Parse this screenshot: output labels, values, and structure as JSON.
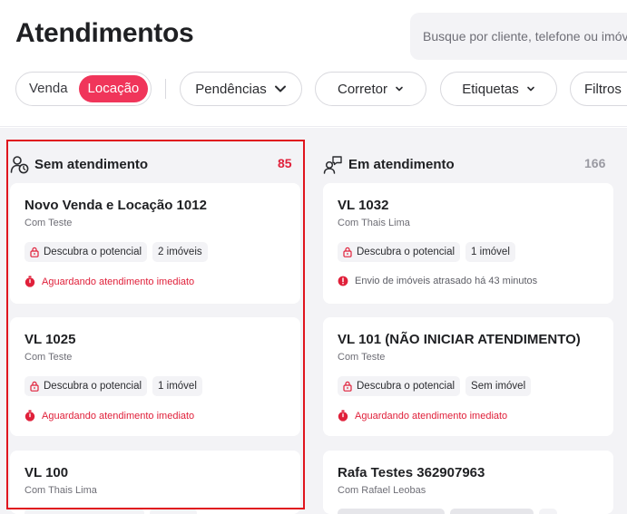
{
  "header": {
    "title": "Atendimentos",
    "search_placeholder": "Busque por cliente, telefone ou imóvel"
  },
  "filters": {
    "mode_options": [
      "Venda",
      "Locação"
    ],
    "mode_selected": "Locação",
    "pendencias": "Pendências",
    "corretor": "Corretor",
    "etiquetas": "Etiquetas",
    "filtros": "Filtros"
  },
  "colors": {
    "accent": "#f0355a",
    "alert": "#e0203a",
    "highlight": "#e0151e"
  },
  "columns": [
    {
      "title": "Sem atendimento",
      "count": "85",
      "icon": "user-clock-icon",
      "cards": [
        {
          "name": "Novo Venda e Locação 1012",
          "owner": "Com Teste",
          "tags": [
            "Descubra o potencial",
            "2 imóveis"
          ],
          "status": "Aguardando atendimento imediato"
        },
        {
          "name": "VL 1025",
          "owner": "Com Teste",
          "tags": [
            "Descubra o potencial",
            "1 imóvel"
          ],
          "status": "Aguardando atendimento imediato"
        },
        {
          "name": "VL 100",
          "owner": "Com Thais Lima"
        }
      ]
    },
    {
      "title": "Em atendimento",
      "count": "166",
      "icon": "users-chat-icon",
      "cards": [
        {
          "name": "VL 1032",
          "owner": "Com Thais Lima",
          "tags": [
            "Descubra o potencial",
            "1 imóvel"
          ],
          "status": "Envio de imóveis atrasado há 43 minutos"
        },
        {
          "name": "VL 101 (NÃO INICIAR ATENDIMENTO)",
          "owner": "Com Teste",
          "tags": [
            "Descubra o potencial",
            "Sem imóvel"
          ],
          "status": "Aguardando atendimento imediato"
        },
        {
          "name": "Rafa Testes 362907963",
          "owner": "Com Rafael Leobas"
        }
      ]
    }
  ]
}
